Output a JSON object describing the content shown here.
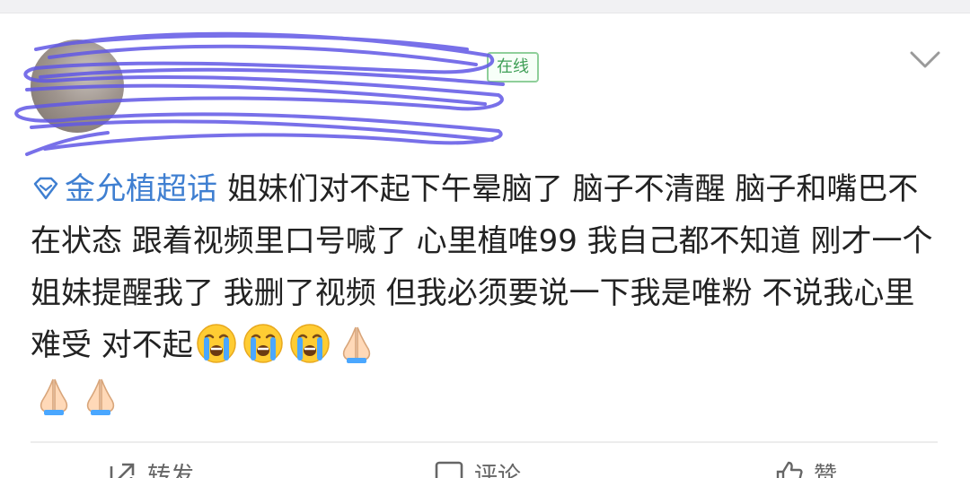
{
  "post": {
    "online_badge": "在线",
    "topic": "金允植超话",
    "text": "姐妹们对不起下午晕脑了 脑子不清醒 脑子和嘴巴不在状态 跟着视频里口号喊了 心里植唯99 我自己都不知道 刚才一个姐妹提醒我了 我删了视频 但我必须要说一下我是唯粉 不说我心里难受 对不起",
    "trailing_emojis": [
      "crying-face",
      "crying-face",
      "crying-face",
      "folded-hands",
      "folded-hands",
      "folded-hands"
    ]
  },
  "actions": {
    "repost_label": "转发",
    "comment_label": "评论",
    "like_label": "赞"
  }
}
